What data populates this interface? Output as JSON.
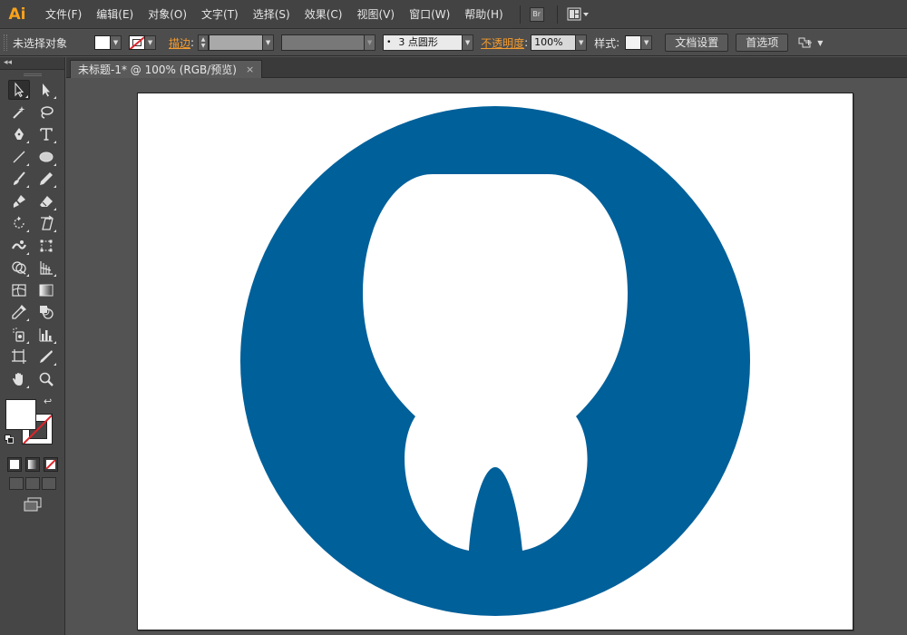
{
  "app": {
    "logo_text": "Ai"
  },
  "menu": [
    "文件(F)",
    "编辑(E)",
    "对象(O)",
    "文字(T)",
    "选择(S)",
    "效果(C)",
    "视图(V)",
    "窗口(W)",
    "帮助(H)"
  ],
  "menubar_icons": {
    "bridge": "Br",
    "arrange": "arrange-documents-icon"
  },
  "controlbar": {
    "selection_status": "未选择对象",
    "stroke_label": "描边",
    "brush_preset": "3 点圆形",
    "opacity_label": "不透明度",
    "opacity_value": "100%",
    "style_label": "样式",
    "doc_setup_button": "文档设置",
    "preferences_button": "首选项"
  },
  "toolbox": {
    "collapse_glyph": "◂◂"
  },
  "document": {
    "tab_title": "未标题-1* @ 100% (RGB/预览)",
    "close_glyph": "×"
  },
  "artwork": {
    "description_color": "#00609a",
    "circle_color": "#00609a",
    "tooth_color": "#ffffff"
  }
}
